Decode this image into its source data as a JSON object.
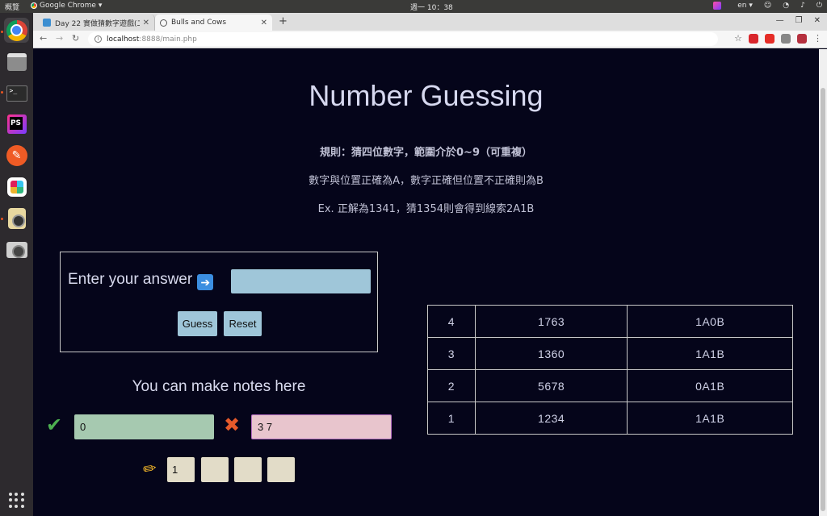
{
  "os_topbar": {
    "activities": "概覽",
    "app_name": "Google Chrome",
    "clock": "週一 10：38",
    "lang": "en"
  },
  "browser": {
    "tabs": [
      {
        "title": "Day 22 實做猜數字遊戲(二"
      },
      {
        "title": "Bulls and Cows"
      }
    ],
    "url_host": "localhost",
    "url_rest": ":8888/main.php"
  },
  "page": {
    "title": "Number Guessing",
    "rules": [
      "規則：猜四位數字，範圍介於0~9（可重複）",
      "數字與位置正確為A，數字正確但位置不正確則為B",
      "Ex. 正解為1341，猜1354則會得到線索2A1B"
    ],
    "answer_label": "Enter your answer",
    "answer_value": "",
    "guess_label": "Guess",
    "reset_label": "Reset",
    "notes_title": "You can make notes here",
    "notes_correct_value": "0",
    "notes_wrong_value": "3 7",
    "digit_boxes": [
      "1",
      "",
      "",
      ""
    ]
  },
  "history": [
    {
      "round": "4",
      "guess": "1763",
      "result": "1A0B"
    },
    {
      "round": "3",
      "guess": "1360",
      "result": "1A1B"
    },
    {
      "round": "2",
      "guess": "5678",
      "result": "0A1B"
    },
    {
      "round": "1",
      "guess": "1234",
      "result": "1A1B"
    }
  ],
  "colors": {
    "background": "#05051a",
    "input_blue": "#9fc6d9",
    "note_green": "#a6c9b0",
    "note_pink": "#e8c5cd",
    "digit_box": "#e2dcc8"
  }
}
